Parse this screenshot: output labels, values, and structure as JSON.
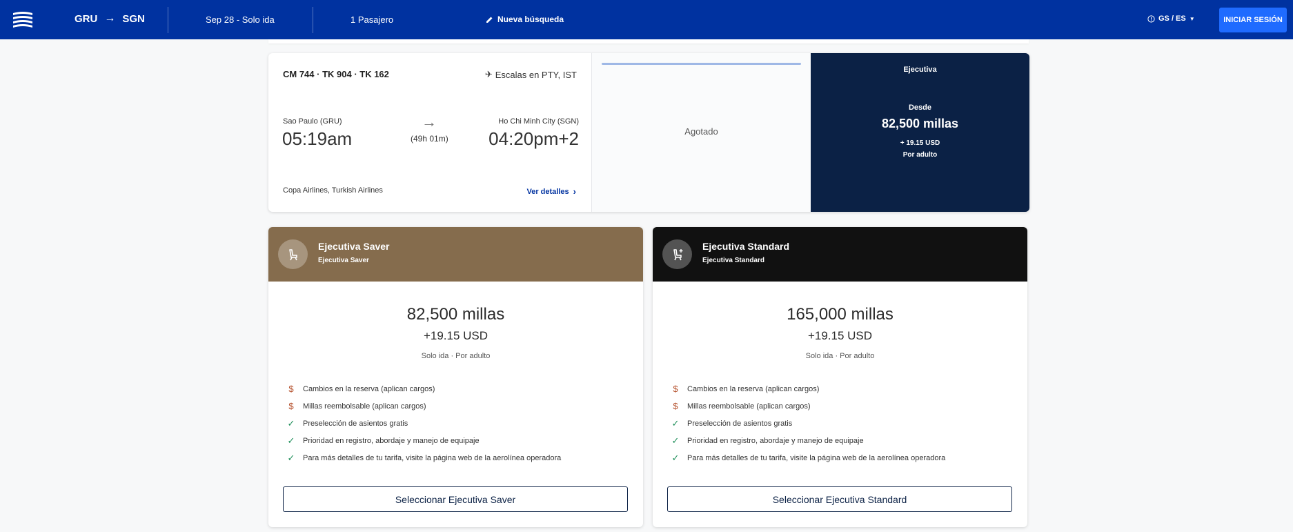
{
  "header": {
    "origin": "GRU",
    "destination": "SGN",
    "date_trip": "Sep 28 - Solo ida",
    "passengers": "1 Pasajero",
    "new_search": "Nueva búsqueda",
    "language": "GS / ES",
    "login": "INICIAR SESIÓN"
  },
  "flight": {
    "numbers": "CM 744 · TK 904 · TK 162",
    "stops": "Escalas en PTY, IST",
    "origin_city": "Sao Paulo (GRU)",
    "departure_time": "05:19am",
    "duration": "(49h 01m)",
    "destination_city": "Ho Chi Minh City (SGN)",
    "arrival_time": "04:20pm+2",
    "airlines": "Copa Airlines, Turkish Airlines",
    "details_link": "Ver detalles",
    "middle_status": "Agotado",
    "cabin": {
      "title": "Ejecutiva",
      "from_label": "Desde",
      "miles": "82,500 millas",
      "usd": "+ 19.15 USD",
      "per_adult": "Por adulto"
    }
  },
  "fares": [
    {
      "name": "Ejecutiva Saver",
      "subtitle": "Ejecutiva Saver",
      "color": "#856c4d",
      "miles": "82,500 millas",
      "usd": "+19.15 USD",
      "note": "Solo ida · Por adulto",
      "features": [
        {
          "icon": "dollar-icon",
          "text": "Cambios en la reserva (aplican cargos)"
        },
        {
          "icon": "dollar-icon",
          "text": "Millas reembolsable (aplican cargos)"
        },
        {
          "icon": "check-icon",
          "text": "Preselección de asientos gratis"
        },
        {
          "icon": "check-icon",
          "text": "Prioridad en registro, abordaje y manejo de equipaje"
        },
        {
          "icon": "check-icon",
          "text": "Para más detalles de tu tarifa, visite la página web de la aerolínea operadora"
        }
      ],
      "button": "Seleccionar Ejecutiva Saver"
    },
    {
      "name": "Ejecutiva Standard",
      "subtitle": "Ejecutiva Standard",
      "color": "#111111",
      "miles": "165,000 millas",
      "usd": "+19.15 USD",
      "note": "Solo ida · Por adulto",
      "features": [
        {
          "icon": "dollar-icon",
          "text": "Cambios en la reserva (aplican cargos)"
        },
        {
          "icon": "dollar-icon",
          "text": "Millas reembolsable (aplican cargos)"
        },
        {
          "icon": "check-icon",
          "text": "Preselección de asientos gratis"
        },
        {
          "icon": "check-icon",
          "text": "Prioridad en registro, abordaje y manejo de equipaje"
        },
        {
          "icon": "check-icon",
          "text": "Para más detalles de tu tarifa, visite la página web de la aerolínea operadora"
        }
      ],
      "button": "Seleccionar Ejecutiva Standard"
    }
  ]
}
